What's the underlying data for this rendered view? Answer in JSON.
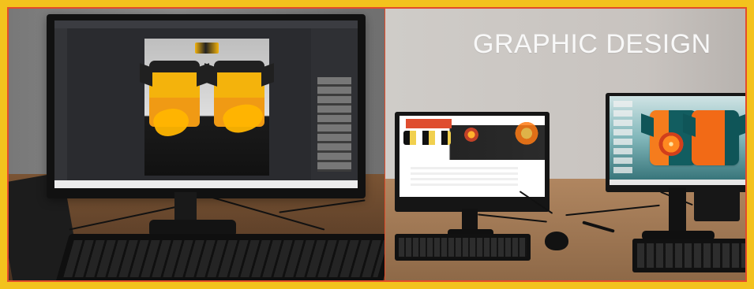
{
  "title": {
    "text": "GRAPHIC DESIGN"
  },
  "colors": {
    "outer_frame": "#f3c21d",
    "inner_border": "#e34c2a",
    "accent_orange": "#f39a1a",
    "accent_teal": "#125d60"
  }
}
